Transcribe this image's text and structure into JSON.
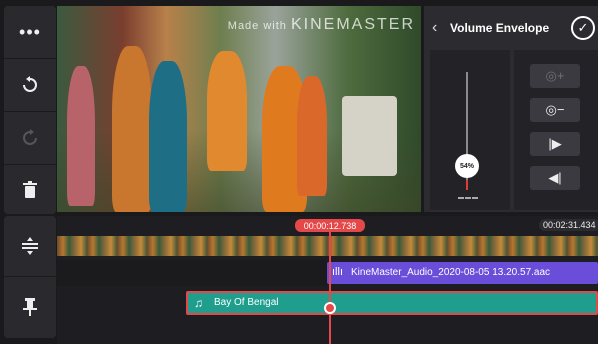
{
  "toolbar": {
    "more_icon": "more-dots-icon",
    "undo_icon": "undo-icon",
    "redo_icon": "redo-icon",
    "delete_icon": "trash-icon",
    "track_icon": "track-height-icon",
    "pin_icon": "pin-icon"
  },
  "preview": {
    "watermark_prefix": "Made with",
    "watermark_brand": "KINEMASTER"
  },
  "panel": {
    "title": "Volume Envelope",
    "back_icon": "chevron-left-icon",
    "confirm_icon": "check-icon",
    "volume_percent": "54%",
    "volume_level": 0.54,
    "buttons": [
      {
        "name": "add-keyframe",
        "icon": "keyframe-add-icon",
        "symbol": "◎+",
        "enabled": false
      },
      {
        "name": "remove-keyframe",
        "icon": "keyframe-remove-icon",
        "symbol": "◎−",
        "enabled": true
      },
      {
        "name": "next-keyframe",
        "icon": "next-keyframe-icon",
        "symbol": "|▶",
        "enabled": true
      },
      {
        "name": "prev-keyframe",
        "icon": "prev-keyframe-icon",
        "symbol": "◀|",
        "enabled": true
      }
    ]
  },
  "timeline": {
    "current_time": "00:00:12.738",
    "total_time": "00:02:31.434",
    "audio_clip": "KineMaster_Audio_2020-08-05 13.20.57.aac",
    "music_clip": "Bay Of Bengal"
  },
  "colors": {
    "accent": "#e54848",
    "audio_track": "#6a4dd8",
    "music_track": "#1f9e8e"
  }
}
